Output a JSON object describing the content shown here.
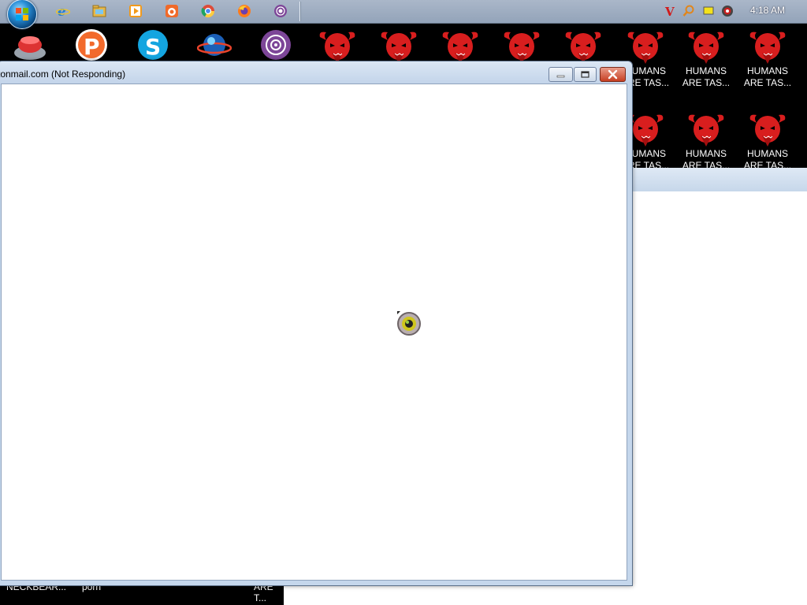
{
  "taskbar": {
    "start_icon": "windows-start-orb",
    "quick_launch": [
      {
        "name": "internet-explorer-icon",
        "color": "#1f7ed8"
      },
      {
        "name": "file-explorer-icon",
        "color": "#e6b84a"
      },
      {
        "name": "media-player-icon",
        "color": "#f29a1b"
      },
      {
        "name": "uc-browser-icon",
        "color": "#f06a2a"
      },
      {
        "name": "chrome-icon",
        "color": "#dd4b39"
      },
      {
        "name": "firefox-icon",
        "color": "#ff7a1b"
      },
      {
        "name": "tor-browser-icon",
        "color": "#7d4698"
      }
    ],
    "tray": [
      {
        "name": "antivirus-v-icon",
        "color": "#d11a1a"
      },
      {
        "name": "search-magnifier-icon",
        "color": "#e0861c"
      },
      {
        "name": "notification-icon",
        "color": "#f4e21a"
      },
      {
        "name": "record-icon",
        "color": "#c91f1f"
      }
    ],
    "clock": "4:18 AM"
  },
  "desktop": {
    "top_row_apps": [
      {
        "name": "cleaner-app-icon"
      },
      {
        "name": "p-app-icon"
      },
      {
        "name": "skype-icon"
      },
      {
        "name": "globe-browser-icon"
      },
      {
        "name": "tor-app-icon"
      }
    ],
    "devil_icons_row1": [
      {
        "label_line1": "",
        "label_line2": ""
      },
      {
        "label_line1": "",
        "label_line2": ""
      },
      {
        "label_line1": "",
        "label_line2": ""
      },
      {
        "label_line1": "",
        "label_line2": ""
      },
      {
        "label_line1": "",
        "label_line2": ""
      },
      {
        "label_line1": "HUMANS",
        "label_line2": "ARE TAS..."
      },
      {
        "label_line1": "HUMANS",
        "label_line2": "ARE TAS..."
      },
      {
        "label_line1": "HUMANS",
        "label_line2": "ARE TAS..."
      }
    ],
    "devil_icons_row2": [
      {
        "label_line1": "HUMANS",
        "label_line2": "ARE TAS..."
      },
      {
        "label_line1": "HUMANS",
        "label_line2": "ARE TAS..."
      },
      {
        "label_line1": "HUMANS",
        "label_line2": "ARE TAS..."
      }
    ],
    "bottom_labels": [
      "NECKBEAR...",
      "porn",
      "ARE T..."
    ],
    "devil_color": "#d81e1e"
  },
  "window": {
    "title": "tonmail.com (Not Responding)",
    "minimize_label": "",
    "maximize_label": "",
    "close_label": ""
  }
}
